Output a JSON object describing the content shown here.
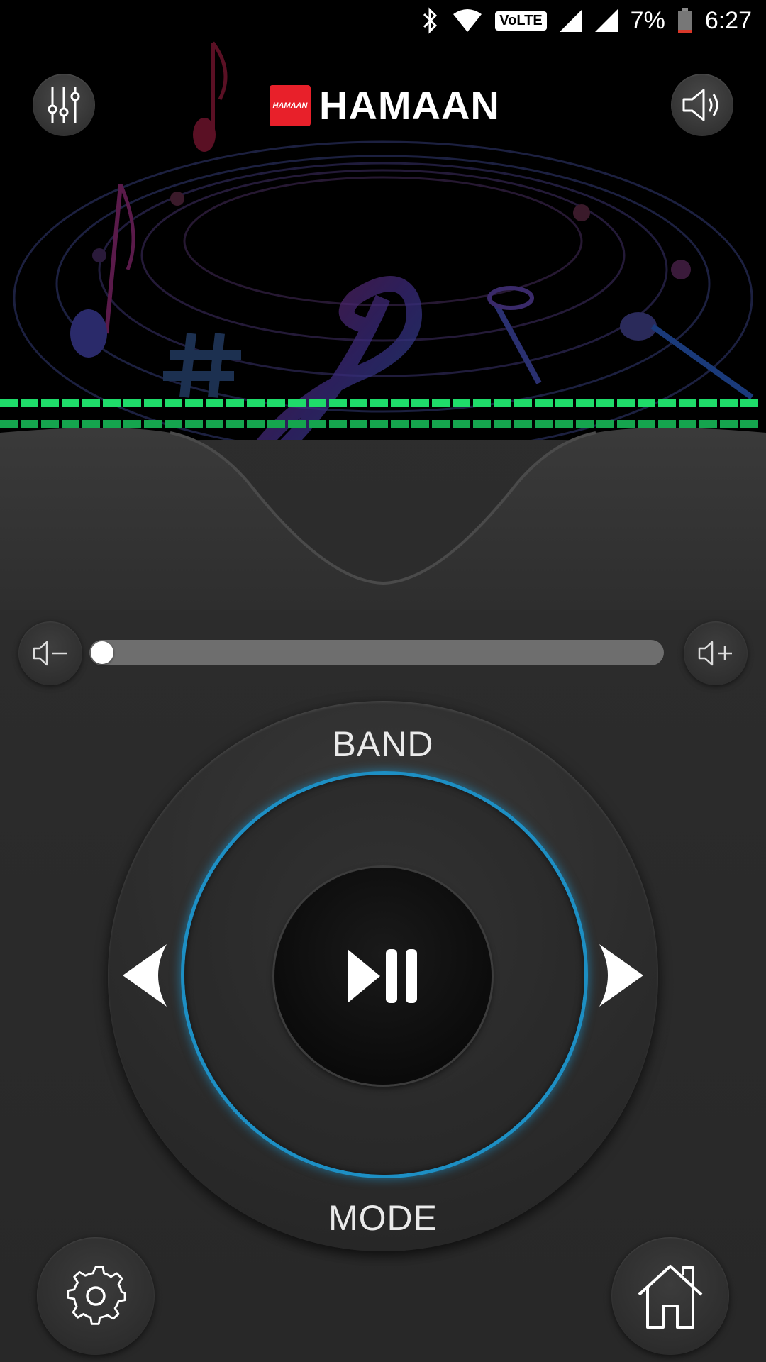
{
  "status_bar": {
    "volte_label": "VoLTE",
    "battery_percent": "7%",
    "time": "6:27",
    "icons": [
      "bluetooth-icon",
      "wifi-icon",
      "signal-icon",
      "signal-icon",
      "battery-icon"
    ]
  },
  "header": {
    "logo_text": "HAMAAN",
    "brand_name": "HAMAAN",
    "left_icon": "equalizer-icon",
    "right_icon": "speaker-icon"
  },
  "volume": {
    "down_icon": "volume-down-icon",
    "up_icon": "volume-up-icon",
    "level": 0.0
  },
  "wheel": {
    "top_label": "BAND",
    "bottom_label": "MODE",
    "center_icon": "play-pause-icon",
    "left_icon": "previous-icon",
    "right_icon": "next-icon"
  },
  "bottom": {
    "left_icon": "settings-icon",
    "right_icon": "home-icon"
  },
  "colors": {
    "accent_ring": "#1d8fc4",
    "meter_green": "#1fdc6a",
    "brand_red": "#e8202a"
  }
}
